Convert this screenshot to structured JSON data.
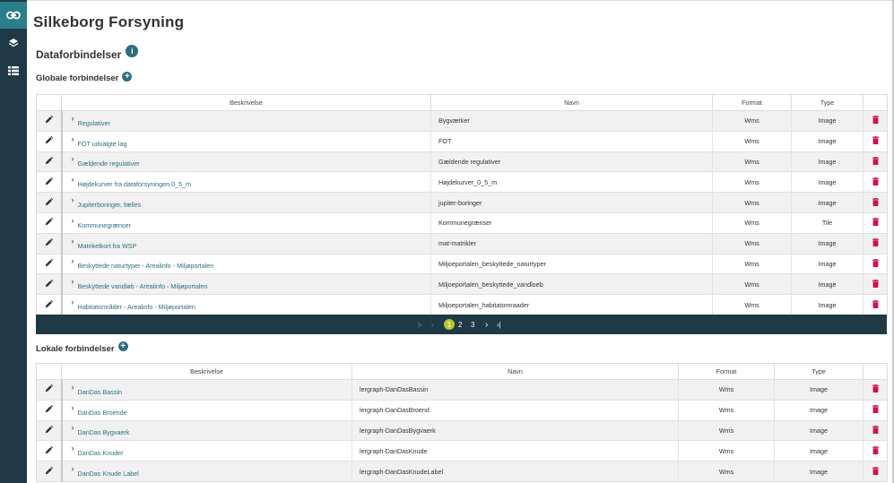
{
  "app_title": "Silkeborg Forsyning",
  "sidebar": {
    "items": [
      {
        "icon": "link-icon",
        "active": true
      },
      {
        "icon": "layers-icon",
        "active": false
      },
      {
        "icon": "list-icon",
        "active": false
      }
    ]
  },
  "section": {
    "title": "Dataforbindelser",
    "info_icon": "i"
  },
  "global": {
    "title": "Globale forbindelser",
    "columns": {
      "description": "Beskrivelse",
      "name": "Navn",
      "format": "Format",
      "type": "Type"
    },
    "rows": [
      {
        "description": "Regulativer",
        "name": "Bygværker",
        "format": "Wms",
        "type": "Image"
      },
      {
        "description": "FOT udvalgte lag",
        "name": "FOT",
        "format": "Wms",
        "type": "Image"
      },
      {
        "description": "Gældende regulativer",
        "name": "Gældende regulativer",
        "format": "Wms",
        "type": "Image"
      },
      {
        "description": "Højdekurver fra dataforsyningen 0_5_m",
        "name": "Højdekurver_0_5_m",
        "format": "Wms",
        "type": "Image"
      },
      {
        "description": "Jupiterboringer, fælles",
        "name": "jupiter-boringer",
        "format": "Wms",
        "type": "Image"
      },
      {
        "description": "Kommunegrænser",
        "name": "Kommunegrænser",
        "format": "Wms",
        "type": "Tile"
      },
      {
        "description": "Matrikelkort fra WSP",
        "name": "mat-matrikler",
        "format": "Wms",
        "type": "Image"
      },
      {
        "description": "Beskyttede naturtyper - Arealinfo - Miljøportalen",
        "name": "Miljoeportalen_beskyttede_naturtyper",
        "format": "Wms",
        "type": "Image"
      },
      {
        "description": "Beskyttede vandløb - Arealinfo - Miljøportalen",
        "name": "Miljoeportalen_beskyttede_vandloeb",
        "format": "Wms",
        "type": "Image"
      },
      {
        "description": "Habitatområder - Arealinfo - Miljøportalen",
        "name": "Miljoeportalen_habitatomraader",
        "format": "Wms",
        "type": "Image"
      }
    ]
  },
  "pagination": {
    "first": "|‹",
    "prev": "‹",
    "pages": [
      "1",
      "2",
      "3"
    ],
    "current_page": "1",
    "next": "›",
    "last": "›|"
  },
  "local": {
    "title": "Lokale forbindelser",
    "columns": {
      "description": "Beskrivelse",
      "name": "Navn",
      "format": "Format",
      "type": "Type"
    },
    "rows": [
      {
        "description": "DanDas Bassin",
        "name": "lergraph-DanDasBassin",
        "format": "Wms",
        "type": "Image"
      },
      {
        "description": "DanDas Broende",
        "name": "lergraph-DanDasBroend",
        "format": "Wms",
        "type": "Image"
      },
      {
        "description": "DanDas Bygvaerk",
        "name": "lergraph-DanDasBygvaerk",
        "format": "Wms",
        "type": "Image"
      },
      {
        "description": "DanDas Knuder",
        "name": "lergraph-DanDasKnude",
        "format": "Wms",
        "type": "Image"
      },
      {
        "description": "DanDas Knude Label",
        "name": "lergraph-DanDasKnudeLabel",
        "format": "Wms",
        "type": "Image"
      }
    ]
  },
  "colors": {
    "sidebar_bg": "#1f3a46",
    "sidebar_active": "#2a7f8a",
    "accent": "#2a6f80",
    "link": "#2c6e7c",
    "delete": "#d0104c",
    "pager_current": "#b7c82c"
  }
}
